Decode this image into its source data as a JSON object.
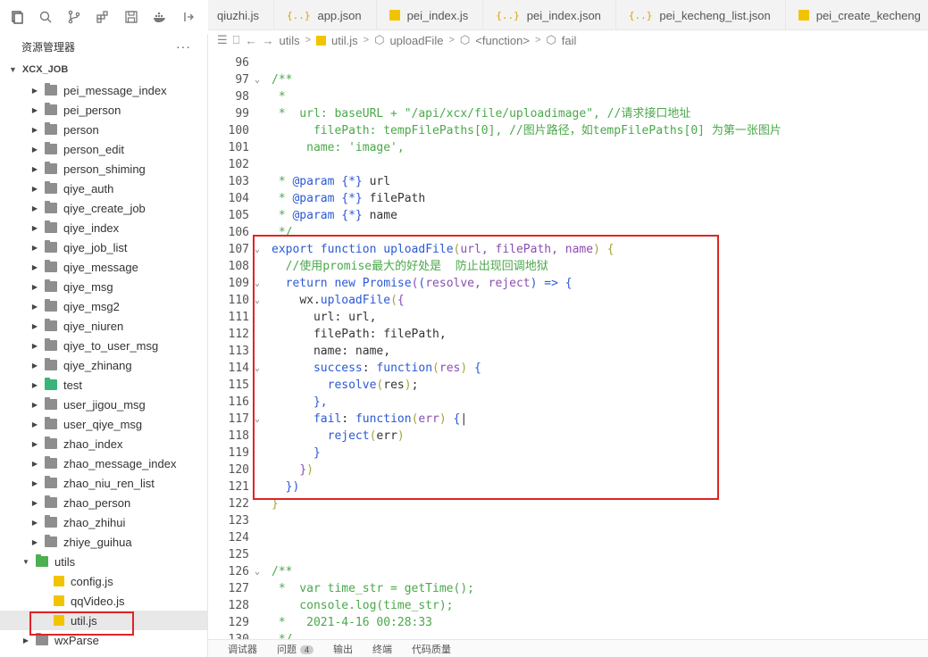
{
  "activity": {
    "icons": [
      "files-icon",
      "search-icon",
      "source-control-icon",
      "extensions-icon",
      "save-icon",
      "docker-icon",
      "split-editor-icon"
    ]
  },
  "tabs": [
    {
      "label": "qiuzhi.js",
      "type": "js"
    },
    {
      "label": "app.json",
      "type": "json"
    },
    {
      "label": "pei_index.js",
      "type": "js"
    },
    {
      "label": "pei_index.json",
      "type": "json"
    },
    {
      "label": "pei_kecheng_list.json",
      "type": "json"
    },
    {
      "label": "pei_create_kecheng",
      "type": "js"
    }
  ],
  "sidebar": {
    "title": "资源管理器",
    "more": "···",
    "root": "XCX_JOB",
    "items": [
      {
        "label": "pei_message_index",
        "kind": "folder"
      },
      {
        "label": "pei_person",
        "kind": "folder"
      },
      {
        "label": "person",
        "kind": "folder"
      },
      {
        "label": "person_edit",
        "kind": "folder"
      },
      {
        "label": "person_shiming",
        "kind": "folder"
      },
      {
        "label": "qiye_auth",
        "kind": "folder"
      },
      {
        "label": "qiye_create_job",
        "kind": "folder"
      },
      {
        "label": "qiye_index",
        "kind": "folder"
      },
      {
        "label": "qiye_job_list",
        "kind": "folder"
      },
      {
        "label": "qiye_message",
        "kind": "folder"
      },
      {
        "label": "qiye_msg",
        "kind": "folder"
      },
      {
        "label": "qiye_msg2",
        "kind": "folder"
      },
      {
        "label": "qiye_niuren",
        "kind": "folder"
      },
      {
        "label": "qiye_to_user_msg",
        "kind": "folder"
      },
      {
        "label": "qiye_zhinang",
        "kind": "folder"
      },
      {
        "label": "test",
        "kind": "folder-green"
      },
      {
        "label": "user_jigou_msg",
        "kind": "folder"
      },
      {
        "label": "user_qiye_msg",
        "kind": "folder"
      },
      {
        "label": "zhao_index",
        "kind": "folder"
      },
      {
        "label": "zhao_message_index",
        "kind": "folder"
      },
      {
        "label": "zhao_niu_ren_list",
        "kind": "folder"
      },
      {
        "label": "zhao_person",
        "kind": "folder"
      },
      {
        "label": "zhao_zhihui",
        "kind": "folder"
      },
      {
        "label": "zhiye_guihua",
        "kind": "folder"
      }
    ],
    "utils": {
      "label": "utils",
      "children": [
        "config.js",
        "qqVideo.js",
        "util.js"
      ]
    },
    "wxparse": "wxParse"
  },
  "breadcrumb": [
    "utils",
    "util.js",
    "uploadFile",
    "<function>",
    "fail"
  ],
  "editor": {
    "lines": [
      {
        "n": "96",
        "fold": "",
        "html": ""
      },
      {
        "n": "97",
        "fold": "v",
        "html": "<span class='c-com'>/**</span>"
      },
      {
        "n": "98",
        "fold": "",
        "html": "<span class='c-com'> *</span>"
      },
      {
        "n": "99",
        "fold": "",
        "html": "<span class='c-com'> *  url: baseURL + \"/api/xcx/file/uploadimage\", //请求接口地址</span>"
      },
      {
        "n": "100",
        "fold": "",
        "html": "<span class='c-com'>      filePath: tempFilePaths[0], //图片路径，如tempFilePaths[0] 为第一张图片</span>"
      },
      {
        "n": "101",
        "fold": "",
        "html": "<span class='c-com'>     name: 'image',</span>"
      },
      {
        "n": "102",
        "fold": "",
        "html": ""
      },
      {
        "n": "103",
        "fold": "",
        "html": "<span class='c-com'> * </span><span class='c-kw'>@param</span><span class='c-com'> </span><span class='c-kw'>{*}</span><span class='c-pl'> url</span>"
      },
      {
        "n": "104",
        "fold": "",
        "html": "<span class='c-com'> * </span><span class='c-kw'>@param</span><span class='c-com'> </span><span class='c-kw'>{*}</span><span class='c-pl'> filePath</span>"
      },
      {
        "n": "105",
        "fold": "",
        "html": "<span class='c-com'> * </span><span class='c-kw'>@param</span><span class='c-com'> </span><span class='c-kw'>{*}</span><span class='c-pl'> name</span>"
      },
      {
        "n": "106",
        "fold": "",
        "html": "<span class='c-com'> */</span>"
      },
      {
        "n": "107",
        "fold": "v",
        "html": "<span class='c-kw'>export</span> <span class='c-kw'>function</span> <span class='c-fn'>uploadFile</span><span class='c-tag'>(</span><span class='c-par'>url, filePath, name</span><span class='c-tag'>)</span> <span class='c-tag'>{</span>"
      },
      {
        "n": "108",
        "fold": "",
        "html": "  <span class='c-com'>//使用promise最大的好处是  防止出现回调地狱</span>"
      },
      {
        "n": "109",
        "fold": "v",
        "html": "  <span class='c-kw'>return</span> <span class='c-kw'>new</span> <span class='c-fn'>Promise</span><span class='c-par'>(</span><span class='c-kw'>(</span><span class='c-par'>resolve, reject</span><span class='c-kw'>)</span> <span class='c-kw'>=&gt;</span> <span class='c-kw'>{</span>"
      },
      {
        "n": "110",
        "fold": "v",
        "html": "    <span class='c-pl'>wx.</span><span class='c-fn'>uploadFile</span><span class='c-tag'>(</span><span class='c-par'>{</span>"
      },
      {
        "n": "111",
        "fold": "",
        "html": "      <span class='c-pl'>url: url,</span>"
      },
      {
        "n": "112",
        "fold": "",
        "html": "      <span class='c-pl'>filePath: filePath,</span>"
      },
      {
        "n": "113",
        "fold": "",
        "html": "      <span class='c-pl'>name: name,</span>"
      },
      {
        "n": "114",
        "fold": "v",
        "html": "      <span class='c-fn'>success</span><span class='c-pl'>: </span><span class='c-kw'>function</span><span class='c-tag'>(</span><span class='c-par'>res</span><span class='c-tag'>)</span> <span class='c-kw'>{</span>"
      },
      {
        "n": "115",
        "fold": "",
        "html": "        <span class='c-fn'>resolve</span><span class='c-tag'>(</span><span class='c-pl'>res</span><span class='c-tag'>)</span><span class='c-pl'>;</span>"
      },
      {
        "n": "116",
        "fold": "",
        "html": "      <span class='c-kw'>},</span>"
      },
      {
        "n": "117",
        "fold": "v",
        "html": "      <span class='c-fn'>fail</span><span class='c-pl'>: </span><span class='c-kw'>function</span><span class='c-tag'>(</span><span class='c-par'>err</span><span class='c-tag'>)</span> <span class='c-kw'>{</span><span class='c-pl'>|</span>"
      },
      {
        "n": "118",
        "fold": "",
        "html": "        <span class='c-fn'>reject</span><span class='c-tag'>(</span><span class='c-pl'>err</span><span class='c-tag'>)</span>"
      },
      {
        "n": "119",
        "fold": "",
        "html": "      <span class='c-kw'>}</span>"
      },
      {
        "n": "120",
        "fold": "",
        "html": "    <span class='c-par'>}</span><span class='c-tag'>)</span>"
      },
      {
        "n": "121",
        "fold": "",
        "html": "  <span class='c-kw'>})</span>"
      },
      {
        "n": "122",
        "fold": "",
        "html": "<span class='c-tag'>}</span>"
      },
      {
        "n": "123",
        "fold": "",
        "html": ""
      },
      {
        "n": "124",
        "fold": "",
        "html": ""
      },
      {
        "n": "125",
        "fold": "",
        "html": ""
      },
      {
        "n": "126",
        "fold": "v",
        "html": "<span class='c-com'>/**</span>"
      },
      {
        "n": "127",
        "fold": "",
        "html": "<span class='c-com'> *  var time_str = getTime();</span>"
      },
      {
        "n": "128",
        "fold": "",
        "html": "<span class='c-com'>    console.log(time_str);</span>"
      },
      {
        "n": "129",
        "fold": "",
        "html": "<span class='c-com'> *   2021-4-16 00:28:33</span>"
      },
      {
        "n": "130",
        "fold": "",
        "html": "<span class='c-com'> */</span>"
      }
    ]
  },
  "bottom_panel": {
    "tabs": [
      "调试器",
      "问题",
      "输出",
      "终端",
      "代码质量"
    ],
    "problem_count": "4"
  },
  "colors": {
    "highlight_box": "#e02424",
    "js_icon": "#f2c400",
    "json_icon": "#d4a400"
  }
}
